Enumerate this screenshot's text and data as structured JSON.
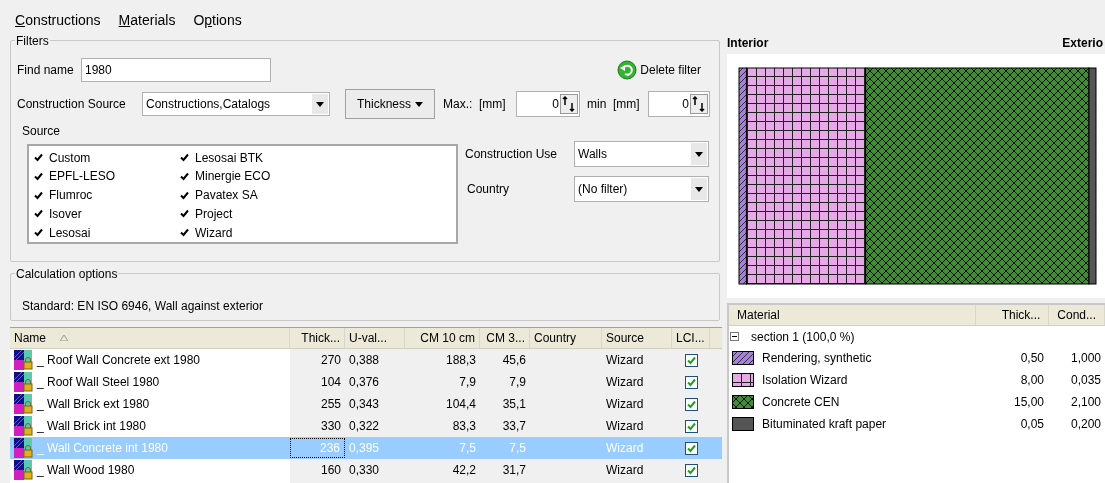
{
  "menu": [
    {
      "accel": "C",
      "after": "onstructions"
    },
    {
      "accel": "M",
      "after": "aterials"
    },
    {
      "before": "O",
      "accel": "p",
      "after": "tions"
    }
  ],
  "filters": {
    "title": "Filters",
    "find_label": "Find name",
    "find_value": "1980",
    "delete_filter": "Delete filter",
    "source_label": "Construction Source",
    "source_value": "Constructions,Catalogs",
    "thickness_button": "Thickness",
    "max_label": "Max.:  [mm]",
    "max_value": "0",
    "min_label": "min  [mm]",
    "min_value": "0",
    "sources_title": "Source",
    "sources": [
      {
        "label": "Custom",
        "checked": true
      },
      {
        "label": "EPFL-LESO",
        "checked": true
      },
      {
        "label": "Flumroc",
        "checked": true
      },
      {
        "label": "Isover",
        "checked": true
      },
      {
        "label": "Lesosai",
        "checked": true
      },
      {
        "label": "Lesosai BTK",
        "checked": true
      },
      {
        "label": "Minergie ECO",
        "checked": true
      },
      {
        "label": "Pavatex SA",
        "checked": true
      },
      {
        "label": "Project",
        "checked": true
      },
      {
        "label": "Wizard",
        "checked": true
      }
    ],
    "use_label": "Construction Use",
    "use_value": "Walls",
    "country_label": "Country",
    "country_value": "(No filter)"
  },
  "calculation": {
    "title": "Calculation options",
    "text": "Standard: EN ISO 6946, Wall against exterior"
  },
  "table": {
    "columns": [
      "Name",
      "Thick...",
      "U-val...",
      "CM 10 cm",
      "CM 3...",
      "Country",
      "Source",
      "LCI..."
    ],
    "rows": [
      {
        "name": "_ Roof Wall Concrete ext 1980",
        "thick": "270",
        "u": "0,388",
        "cm10": "188,3",
        "cm3": "45,6",
        "source": "Wizard",
        "lci": true,
        "selected": false
      },
      {
        "name": "_ Roof Wall Steel 1980",
        "thick": "104",
        "u": "0,376",
        "cm10": "7,9",
        "cm3": "7,9",
        "source": "Wizard",
        "lci": true,
        "selected": false
      },
      {
        "name": "_ Wall Brick ext 1980",
        "thick": "255",
        "u": "0,343",
        "cm10": "104,4",
        "cm3": "35,1",
        "source": "Wizard",
        "lci": true,
        "selected": false
      },
      {
        "name": "_ Wall Brick int 1980",
        "thick": "330",
        "u": "0,322",
        "cm10": "83,3",
        "cm3": "33,7",
        "source": "Wizard",
        "lci": true,
        "selected": false
      },
      {
        "name": "_ Wall Concrete int 1980",
        "thick": "236",
        "u": "0,395",
        "cm10": "7,5",
        "cm3": "7,5",
        "source": "Wizard",
        "lci": true,
        "selected": true
      },
      {
        "name": "_ Wall Wood 1980",
        "thick": "160",
        "u": "0,330",
        "cm10": "42,2",
        "cm3": "31,7",
        "source": "Wizard",
        "lci": true,
        "selected": false
      }
    ]
  },
  "diagram": {
    "interior": "Interior",
    "exterior": "Exterio"
  },
  "materials": {
    "columns": [
      "Material",
      "Thick...",
      "Cond..."
    ],
    "section": "section 1 (100,0 %)",
    "expanded": true,
    "rows": [
      {
        "name": "Rendering, synthetic",
        "thick": "0,50",
        "cond": "1,000",
        "kind": "hatch",
        "color": "#a77fe0"
      },
      {
        "name": "Isolation Wizard",
        "thick": "8,00",
        "cond": "0,035",
        "kind": "grid",
        "color": "#e6a8e6"
      },
      {
        "name": "Concrete CEN",
        "thick": "15,00",
        "cond": "2,100",
        "kind": "crosshatch",
        "color": "#3f8f32"
      },
      {
        "name": "Bituminated kraft paper",
        "thick": "0,05",
        "cond": "0,200",
        "kind": "solid",
        "color": "#555555"
      }
    ]
  }
}
